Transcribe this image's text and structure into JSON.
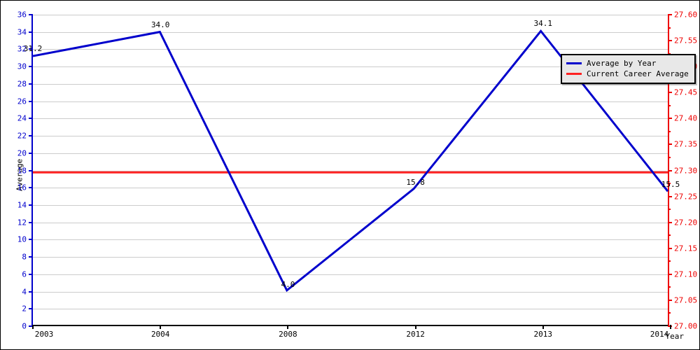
{
  "chart_data": {
    "type": "line",
    "title": "",
    "xlabel": "Year",
    "ylabel": "Average",
    "grid": true,
    "legend_position": "top-right",
    "x": [
      "2003",
      "2004",
      "2008",
      "2012",
      "2013",
      "2014"
    ],
    "categories": [
      "2003",
      "2004",
      "2008",
      "2012",
      "2013",
      "2014"
    ],
    "series": [
      {
        "name": "Average by Year",
        "color": "#0000cc",
        "axis": "left",
        "values": [
          31.2,
          34.0,
          4.0,
          15.8,
          34.1,
          15.5
        ],
        "point_labels": [
          "31.2",
          "34.0",
          "4.0",
          "15.8",
          "34.1",
          "15.5"
        ]
      },
      {
        "name": "Current Career Average",
        "color": "#ff2222",
        "axis": "left",
        "type": "hline",
        "value": 17.7
      }
    ],
    "left_axis": {
      "label": "Average",
      "color": "#0000cc",
      "min": 0,
      "max": 36,
      "step": 2,
      "ticks": [
        "0",
        "2",
        "4",
        "6",
        "8",
        "10",
        "12",
        "14",
        "16",
        "18",
        "20",
        "22",
        "24",
        "26",
        "28",
        "30",
        "32",
        "34",
        "36"
      ]
    },
    "right_axis": {
      "label": "",
      "color": "#ee0000",
      "min": 27.0,
      "max": 27.6,
      "step": 0.05,
      "ticks": [
        "27.00",
        "27.05",
        "27.10",
        "27.15",
        "27.20",
        "27.25",
        "27.30",
        "27.35",
        "27.40",
        "27.45",
        "27.50",
        "27.55",
        "27.60"
      ]
    },
    "x_axis": {
      "label": "Year",
      "color": "#000000",
      "ticks": [
        "2003",
        "2004",
        "2008",
        "2012",
        "2013",
        "2014"
      ]
    }
  },
  "legend": {
    "items": [
      {
        "label": "Average by Year",
        "color": "#0000cc"
      },
      {
        "label": "Current Career Average",
        "color": "#ff2222"
      }
    ]
  }
}
